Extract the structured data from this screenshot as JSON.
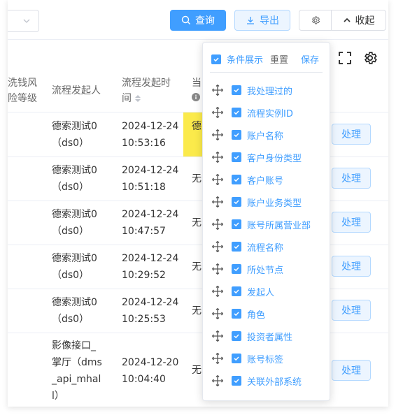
{
  "toolbar": {
    "query_label": "查询",
    "export_label": "导出",
    "collapse_label": "收起"
  },
  "table": {
    "headers": {
      "risk_level_line1": "洗钱风",
      "risk_level_line2": "险等级",
      "initiator": "流程发起人",
      "start_time_line1": "流程发起时",
      "start_time_line2": "间",
      "current_partial": "当"
    },
    "rows": [
      {
        "initiator": [
          "德索测试0",
          "（ds0）"
        ],
        "time": [
          "2024-12-24",
          "10:53:16"
        ],
        "current": "德",
        "current2": "（",
        "action": "处理",
        "highlight": true
      },
      {
        "initiator": [
          "德索测试0",
          "（ds0）"
        ],
        "time": [
          "2024-12-24",
          "10:51:18"
        ],
        "current": "无",
        "action": "处理"
      },
      {
        "initiator": [
          "德索测试0",
          "（ds0）"
        ],
        "time": [
          "2024-12-24",
          "10:47:57"
        ],
        "current": "无",
        "action": "处理"
      },
      {
        "initiator": [
          "德索测试0",
          "（ds0）"
        ],
        "time": [
          "2024-12-24",
          "10:29:52"
        ],
        "current": "无",
        "action": "处理"
      },
      {
        "initiator": [
          "德索测试0",
          "（ds0）"
        ],
        "time": [
          "2024-12-24",
          "10:25:53"
        ],
        "current": "无",
        "action": "处理"
      },
      {
        "initiator": [
          "影像接口_",
          "掌厅（dms",
          "_api_mhal",
          "l）"
        ],
        "time": [
          "2024-12-20",
          "10:04:40"
        ],
        "current": "无",
        "action": "处理"
      }
    ]
  },
  "column_settings": {
    "show_conditions_label": "条件展示",
    "reset_label": "重置",
    "save_label": "保存",
    "items": [
      {
        "label": "我处理过的",
        "checked": true
      },
      {
        "label": "流程实例ID",
        "checked": true
      },
      {
        "label": "账户名称",
        "checked": true
      },
      {
        "label": "客户身份类型",
        "checked": true
      },
      {
        "label": "客户账号",
        "checked": true
      },
      {
        "label": "账户业务类型",
        "checked": true
      },
      {
        "label": "账号所属营业部",
        "checked": true
      },
      {
        "label": "流程名称",
        "checked": true
      },
      {
        "label": "所处节点",
        "checked": true
      },
      {
        "label": "发起人",
        "checked": true
      },
      {
        "label": "角色",
        "checked": true
      },
      {
        "label": "投资者属性",
        "checked": true
      },
      {
        "label": "账号标签",
        "checked": true
      },
      {
        "label": "关联外部系统",
        "checked": true
      }
    ]
  },
  "icons": {
    "search": "search-icon",
    "download": "download-icon",
    "gear": "gear-icon",
    "chevron_up": "chevron-up-icon",
    "fullscreen": "fullscreen-icon",
    "settings": "settings-icon",
    "drag": "drag-handle-icon",
    "info": "info-icon",
    "sort": "sort-icon"
  },
  "colors": {
    "primary": "#409eff",
    "highlight": "#fbea4b"
  }
}
